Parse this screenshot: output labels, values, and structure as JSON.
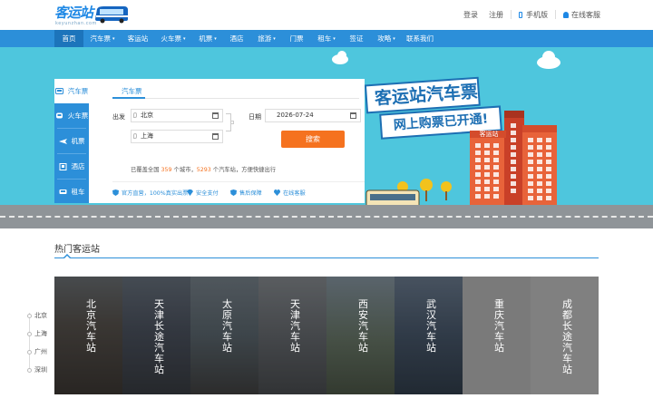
{
  "header": {
    "logo_text": "客运站",
    "logo_sub": "keyunzhan.com",
    "links": [
      "登录",
      "注册",
      "手机版",
      "在线客服"
    ]
  },
  "nav": {
    "items": [
      {
        "label": "首页",
        "dropdown": false,
        "active": true
      },
      {
        "label": "汽车票",
        "dropdown": true
      },
      {
        "label": "客运站",
        "dropdown": false
      },
      {
        "label": "火车票",
        "dropdown": true
      },
      {
        "label": "机票",
        "dropdown": true
      },
      {
        "label": "酒店",
        "dropdown": false
      },
      {
        "label": "旅游",
        "dropdown": true
      },
      {
        "label": "门票",
        "dropdown": false
      },
      {
        "label": "租车",
        "dropdown": true
      },
      {
        "label": "签证",
        "dropdown": false
      },
      {
        "label": "攻略",
        "dropdown": true
      },
      {
        "label": "联系我们",
        "dropdown": false
      }
    ]
  },
  "banner": {
    "headline": "客运站汽车票",
    "subline": "网上购票已开通!",
    "building_sign": "客运站"
  },
  "search": {
    "tabs": [
      {
        "label": "汽车票",
        "icon": "bus-icon",
        "active": true
      },
      {
        "label": "火车票",
        "icon": "train-icon"
      },
      {
        "label": "机票",
        "icon": "plane-icon"
      },
      {
        "label": "酒店",
        "icon": "hotel-icon"
      },
      {
        "label": "租车",
        "icon": "car-icon"
      }
    ],
    "subtab": "汽车票",
    "from_label": "出发",
    "from_value": "北京",
    "to_value": "上海",
    "date_label": "日期",
    "date_value": "2026-07-24",
    "button": "搜索",
    "stats_prefix": "已覆盖全国",
    "stats_cities": "359",
    "stats_middle": "个城市，",
    "stats_stations": "5293",
    "stats_suffix": "个汽车站，方便快捷出行",
    "guarantees": [
      "官方直营，100%真实出票",
      "安全支付",
      "售后保障",
      "在线客服"
    ]
  },
  "section": {
    "title": "热门客运站"
  },
  "side_list": [
    "北京",
    "上海",
    "广州",
    "深圳"
  ],
  "gallery": [
    {
      "name": "北京汽车站",
      "style": "photo1"
    },
    {
      "name": "天津长途汽车站",
      "style": "photo2"
    },
    {
      "name": "太原汽车站",
      "style": "photo3"
    },
    {
      "name": "天津汽车站",
      "style": "photo4"
    },
    {
      "name": "西安汽车站",
      "style": "photo5"
    },
    {
      "name": "武汉汽车站",
      "style": "photo6"
    },
    {
      "name": "重庆汽车站",
      "style": "grey"
    },
    {
      "name": "成都长途汽车站",
      "style": "grey2"
    }
  ]
}
